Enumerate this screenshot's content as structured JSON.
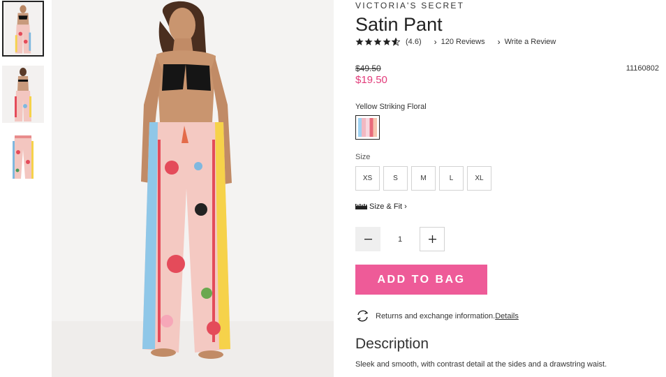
{
  "brand": "VICTORIA'S SECRET",
  "product": {
    "title": "Satin Pant",
    "rating_value": 4.6,
    "rating_text": "(4.6)",
    "reviews_label": "120 Reviews",
    "write_review_label": "Write a Review",
    "old_price": "$49.50",
    "new_price": "$19.50",
    "sku": "11160802",
    "color_label": "Yellow Striking Floral",
    "size_label": "Size",
    "sizes": [
      "XS",
      "S",
      "M",
      "L",
      "XL"
    ],
    "size_fit_label": "Size & Fit",
    "quantity": "1",
    "add_to_bag_label": "ADD TO BAG",
    "returns_text": "Returns and exchange information.",
    "details_link": "Details",
    "description_title": "Description",
    "description_text": "Sleek and smooth, with contrast detail at the sides and a drawstring waist."
  },
  "colors": {
    "accent": "#ee5b98",
    "sale_price": "#e23b7a"
  },
  "icons": {
    "star": "star-icon",
    "chevron": "chevron-right-icon",
    "ruler": "ruler-icon",
    "minus": "minus-icon",
    "plus": "plus-icon",
    "returns": "returns-exchange-icon"
  }
}
